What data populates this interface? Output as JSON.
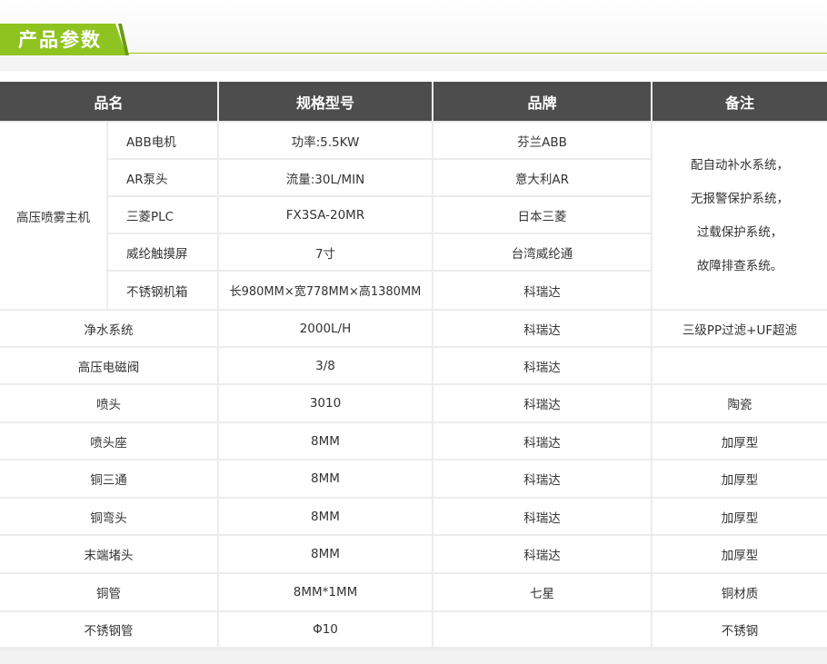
{
  "section_title": "产品参数",
  "header": {
    "name": "品名",
    "spec": "规格型号",
    "brand": "品牌",
    "note": "备注"
  },
  "main_unit": {
    "label": "高压喷雾主机",
    "components": [
      {
        "name": "ABB电机",
        "spec": "功率:5.5KW",
        "brand": "芬兰ABB"
      },
      {
        "name": "AR泵头",
        "spec": "流量:30L/MIN",
        "brand": "意大利AR"
      },
      {
        "name": "三菱PLC",
        "spec": "FX3SA-20MR",
        "brand": "日本三菱"
      },
      {
        "name": "威纶触摸屏",
        "spec": "7寸",
        "brand": "台湾威纶通"
      },
      {
        "name": "不锈钢机箱",
        "spec": "长980MM×宽778MM×高1380MM",
        "brand": "科瑞达"
      }
    ],
    "note_lines": [
      "配自动补水系统，",
      "无报警保护系统，",
      "过载保护系统，",
      "故障排查系统。"
    ]
  },
  "rows": [
    {
      "name": "净水系统",
      "spec": "2000L/H",
      "brand": "科瑞达",
      "note": "三级PP过滤+UF超滤"
    },
    {
      "name": "高压电磁阀",
      "spec": "3/8",
      "brand": "科瑞达",
      "note": ""
    },
    {
      "name": "喷头",
      "spec": "3010",
      "brand": "科瑞达",
      "note": "陶瓷"
    },
    {
      "name": "喷头座",
      "spec": "8MM",
      "brand": "科瑞达",
      "note": "加厚型"
    },
    {
      "name": "铜三通",
      "spec": "8MM",
      "brand": "科瑞达",
      "note": "加厚型"
    },
    {
      "name": "铜弯头",
      "spec": "8MM",
      "brand": "科瑞达",
      "note": "加厚型"
    },
    {
      "name": "末端堵头",
      "spec": "8MM",
      "brand": "科瑞达",
      "note": "加厚型"
    },
    {
      "name": "铜管",
      "spec": "8MM*1MM",
      "brand": "七星",
      "note": "铜材质"
    },
    {
      "name": "不锈钢管",
      "spec": "Φ10",
      "brand": "",
      "note": "不锈钢"
    }
  ],
  "colors": {
    "accent": "#8fc31f",
    "header_bg": "#4d4d4d",
    "grid": "#ececec"
  }
}
